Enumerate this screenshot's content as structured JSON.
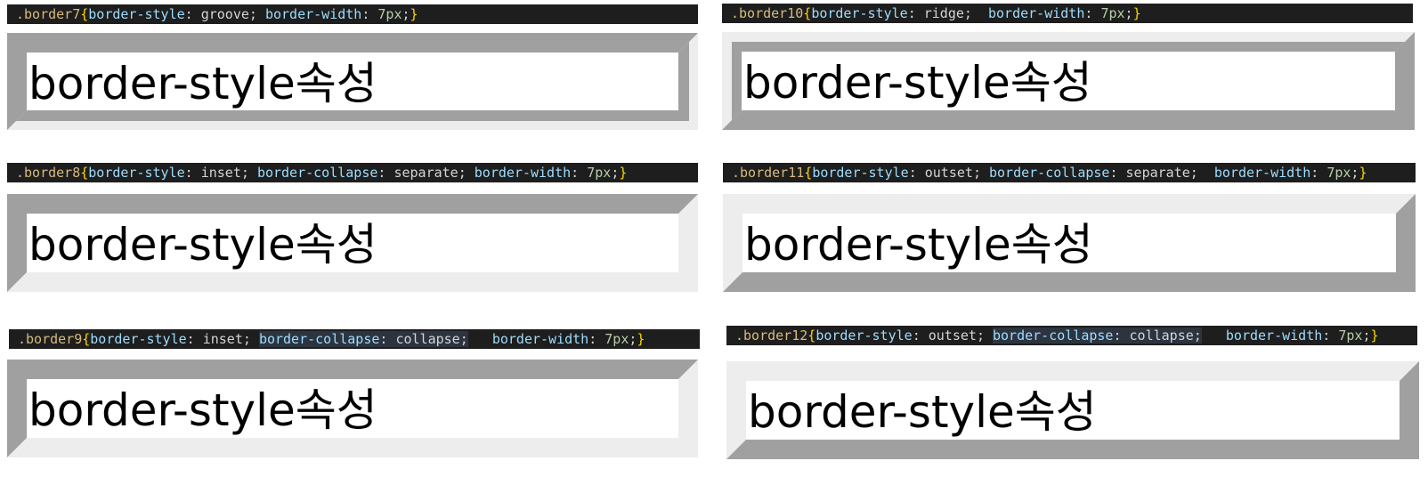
{
  "demo_text": "border-style속성",
  "rows": [
    {
      "selector": ".border7",
      "decls": [
        {
          "prop": "border-style",
          "value": "groove"
        },
        {
          "prop": "border-width",
          "value": "7px"
        }
      ]
    },
    {
      "selector": ".border10",
      "decls": [
        {
          "prop": "border-style",
          "value": "ridge"
        },
        {
          "prop": "border-width",
          "value": "7px"
        }
      ]
    },
    {
      "selector": ".border8",
      "decls": [
        {
          "prop": "border-style",
          "value": "inset"
        },
        {
          "prop": "border-collapse",
          "value": "separate"
        },
        {
          "prop": "border-width",
          "value": "7px"
        }
      ]
    },
    {
      "selector": ".border11",
      "decls": [
        {
          "prop": "border-style",
          "value": "outset"
        },
        {
          "prop": "border-collapse",
          "value": "separate"
        },
        {
          "prop": "border-width",
          "value": "7px"
        }
      ]
    },
    {
      "selector": ".border9",
      "decls": [
        {
          "prop": "border-style",
          "value": "inset"
        },
        {
          "prop": "border-collapse",
          "value": "collapse"
        },
        {
          "prop": "border-width",
          "value": "7px"
        }
      ]
    },
    {
      "selector": ".border12",
      "decls": [
        {
          "prop": "border-style",
          "value": "outset"
        },
        {
          "prop": "border-collapse",
          "value": "collapse"
        },
        {
          "prop": "border-width",
          "value": "7px"
        }
      ]
    }
  ],
  "colors": {
    "editor_bg": "#1e1e1e",
    "selector": "#d7ba7d",
    "brace": "#ffd700",
    "property": "#9cdcfe",
    "number": "#b5cea8",
    "border_dark": "#a0a0a0",
    "border_light": "#ededed"
  }
}
